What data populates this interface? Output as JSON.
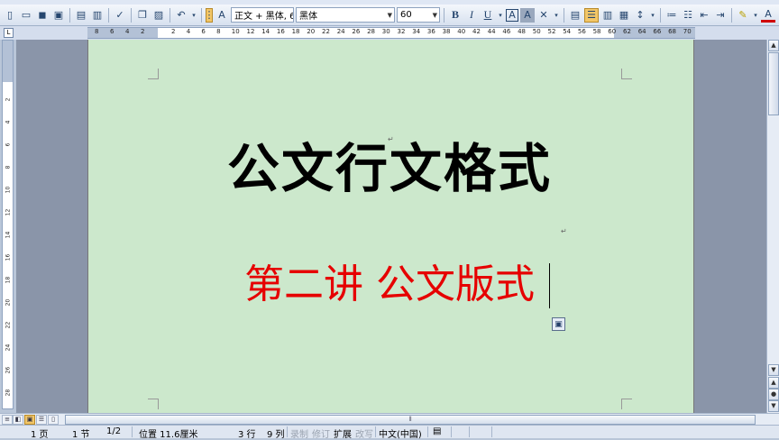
{
  "toolbar": {
    "style_combo": "正文 + 黑体, 6(",
    "font_combo": "黑体",
    "size_combo": "60",
    "bold_label": "B",
    "italic_label": "I",
    "underline_label": "U",
    "highlighted_tool": "align-center"
  },
  "ruler": {
    "left_numbers": [
      "8",
      "6",
      "4",
      "2"
    ],
    "numbers": [
      "2",
      "4",
      "6",
      "8",
      "10",
      "12",
      "14",
      "16",
      "18",
      "20",
      "22",
      "24",
      "26",
      "28",
      "30",
      "32",
      "34",
      "36",
      "38",
      "40",
      "42",
      "44",
      "46",
      "48",
      "50",
      "52",
      "54",
      "56",
      "58",
      "60",
      "62",
      "64",
      "66",
      "68",
      "70"
    ],
    "corner_label": "L",
    "vertical_numbers": [
      "2",
      "4",
      "6",
      "8",
      "10",
      "12",
      "14",
      "16",
      "18",
      "20",
      "22",
      "24",
      "26",
      "28"
    ]
  },
  "document": {
    "title": "公文行文格式",
    "subtitle": "第二讲 公文版式",
    "page_color": "#cce8cc",
    "title_color": "#000000",
    "subtitle_color": "#e60000"
  },
  "status": {
    "page": "1 页",
    "section": "1 节",
    "page_of": "1/2",
    "position": "位置 11.6厘米",
    "line": "3 行",
    "column": "9 列",
    "rec": "录制",
    "trk": "修订",
    "ext": "扩展",
    "ovr": "改写",
    "language": "中文(中国)"
  },
  "icons": [
    "new-icon",
    "open-icon",
    "save-icon",
    "permission-icon",
    "print-icon",
    "print-preview-icon",
    "spelling-icon",
    "copy-icon",
    "paste-icon",
    "undo-icon",
    "styles-icon",
    "bold-icon",
    "italic-icon",
    "underline-icon",
    "char-border-icon",
    "char-shading-icon",
    "scale-icon",
    "align-left-icon",
    "align-center-icon",
    "align-right-icon",
    "justify-icon",
    "line-spacing-icon",
    "numbering-icon",
    "bullets-icon",
    "decrease-indent-icon",
    "increase-indent-icon",
    "highlight-icon",
    "font-color-icon",
    "phonetic-icon",
    "enclose-icon"
  ]
}
